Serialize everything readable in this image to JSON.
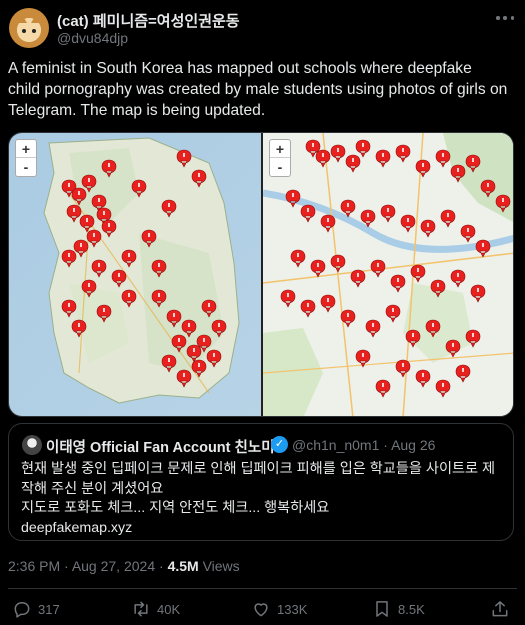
{
  "author": {
    "display_name": "(cat) 페미니즘=여성인권운동",
    "handle": "@dvu84djp"
  },
  "tweet": {
    "text": "A feminist in South Korea has mapped out schools where deepfake child pornography was created by male students using photos of girls on Telegram. The map is being updated."
  },
  "media": {
    "zoom_in": "+",
    "zoom_out": "-",
    "left_map_pin_count": 38,
    "right_map_pin_count": 50
  },
  "quote": {
    "name": "이태영 Official Fan Account 친노미",
    "handle": "@ch1n_n0m1",
    "date": "Aug 26",
    "lines": [
      "현재 발생 중인 딥페이크 문제로 인해 딥페이크 피해를 입은 학교들을 사이트로 제",
      "작해 주신 분이 계셨어요",
      "지도로 포화도 체크... 지역 안전도 체크... 행복하세요",
      "deepfakemap.xyz"
    ]
  },
  "meta": {
    "time": "2:36 PM",
    "date": "Aug 27, 2024",
    "views_count": "4.5M",
    "views_label": "Views"
  },
  "actions": {
    "replies": "317",
    "reposts": "40K",
    "likes": "133K",
    "bookmarks": "8.5K"
  },
  "colors": {
    "pin": "#e8201e",
    "verified": "#1d9bf0",
    "muted": "#71767b"
  }
}
